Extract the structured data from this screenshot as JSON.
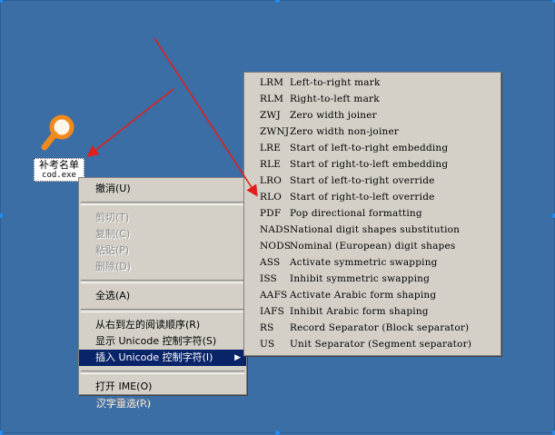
{
  "desktop_icon": {
    "name": "补考名单",
    "file": "cod.exe"
  },
  "context_menu": {
    "items": [
      {
        "label": "撤消(U)",
        "enabled": true
      },
      {
        "label": "剪切(T)",
        "enabled": false
      },
      {
        "label": "复制(C)",
        "enabled": false
      },
      {
        "label": "粘贴(P)",
        "enabled": false
      },
      {
        "label": "删除(D)",
        "enabled": false
      },
      {
        "label": "全选(A)",
        "enabled": true
      },
      {
        "label": "从右到左的阅读顺序(R)",
        "enabled": true
      },
      {
        "label": "显示 Unicode 控制字符(S)",
        "enabled": true
      },
      {
        "label": "插入 Unicode 控制字符(I)",
        "enabled": true,
        "selected": true
      },
      {
        "label": "打开 IME(O)",
        "enabled": true
      },
      {
        "label": "汉字重选(R)",
        "enabled": false
      }
    ],
    "submenu_arrow": "▶"
  },
  "unicode_submenu": {
    "items": [
      {
        "code": "LRM",
        "desc": "Left-to-right mark"
      },
      {
        "code": "RLM",
        "desc": "Right-to-left mark"
      },
      {
        "code": "ZWJ",
        "desc": "Zero width joiner"
      },
      {
        "code": "ZWNJ",
        "desc": "Zero width non-joiner"
      },
      {
        "code": "LRE",
        "desc": "Start of left-to-right embedding"
      },
      {
        "code": "RLE",
        "desc": "Start of right-to-left embedding"
      },
      {
        "code": "LRO",
        "desc": "Start of left-to-right override"
      },
      {
        "code": "RLO",
        "desc": "Start of right-to-left override"
      },
      {
        "code": "PDF",
        "desc": "Pop directional formatting"
      },
      {
        "code": "NADS",
        "desc": "National digit shapes substitution"
      },
      {
        "code": "NODS",
        "desc": "Nominal (European) digit shapes"
      },
      {
        "code": "ASS",
        "desc": "Activate symmetric swapping"
      },
      {
        "code": "ISS",
        "desc": "Inhibit symmetric swapping"
      },
      {
        "code": "AAFS",
        "desc": "Activate Arabic form shaping"
      },
      {
        "code": "IAFS",
        "desc": "Inhibit Arabic form shaping"
      },
      {
        "code": "RS",
        "desc": "Record Separator (Block separator)"
      },
      {
        "code": "US",
        "desc": "Unit Separator (Segment separator)"
      }
    ]
  },
  "colors": {
    "desktop": "#3a6ea5",
    "menu_bg": "#d4d0c8",
    "highlight": "#0a246a",
    "annotation": "#e0201c"
  }
}
